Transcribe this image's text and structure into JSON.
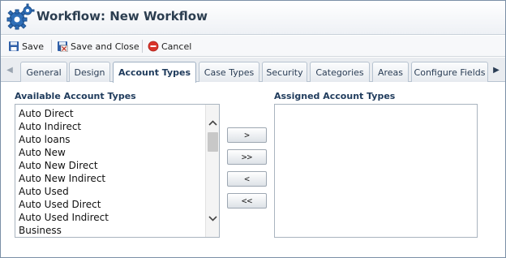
{
  "window": {
    "title": "Workflow: New Workflow"
  },
  "toolbar": {
    "save_label": "Save",
    "save_close_label": "Save and Close",
    "cancel_label": "Cancel"
  },
  "tabs": [
    {
      "label": "General"
    },
    {
      "label": "Design"
    },
    {
      "label": "Account Types"
    },
    {
      "label": "Case Types"
    },
    {
      "label": "Security"
    },
    {
      "label": "Categories"
    },
    {
      "label": "Areas"
    },
    {
      "label": "Configure Fields"
    }
  ],
  "active_tab": "Account Types",
  "available": {
    "label": "Available Account Types",
    "items": [
      "Auto Direct",
      "Auto Indirect",
      "Auto loans",
      "Auto New",
      "Auto New Direct",
      "Auto New Indirect",
      "Auto Used",
      "Auto Used Direct",
      "Auto Used Indirect",
      "Business"
    ]
  },
  "assigned": {
    "label": "Assigned Account Types",
    "items": []
  },
  "move_buttons": {
    "add": ">",
    "add_all": ">>",
    "remove": "<",
    "remove_all": "<<"
  },
  "colors": {
    "accent": "#1f3b5c",
    "border": "#a9b4bf"
  }
}
